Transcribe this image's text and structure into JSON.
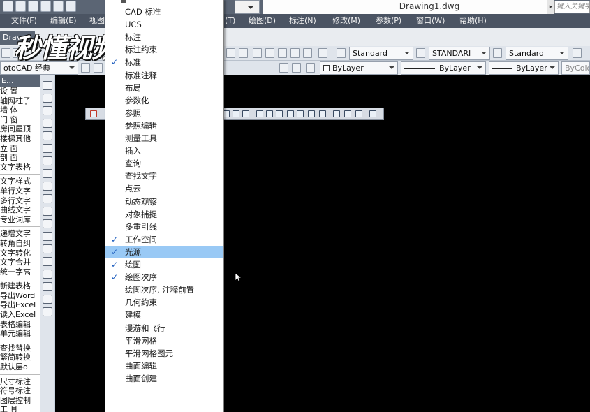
{
  "titlebar": {
    "document_title": "Drawing1.dwg",
    "search_placeholder": "键入关键字"
  },
  "menubar": {
    "items": [
      {
        "label": "文件(F)"
      },
      {
        "label": "编辑(E)"
      },
      {
        "label": "视图"
      },
      {
        "label": "(T)"
      },
      {
        "label": "绘图(D)"
      },
      {
        "label": "标注(N)"
      },
      {
        "label": "修改(M)"
      },
      {
        "label": "参数(P)"
      },
      {
        "label": "窗口(W)"
      },
      {
        "label": "帮助(H)"
      }
    ]
  },
  "tabs": {
    "drawing_tab": "Drav"
  },
  "toolbar": {
    "text_style": "Standard",
    "dim_style": "STANDARI",
    "table_style": "Standard",
    "workspace": "otoCAD 经典",
    "layer_color": "ByLayer",
    "linetype": "ByLayer",
    "lineweight": "ByLayer",
    "plot_style": "ByColo"
  },
  "left_panel": {
    "header": "E...",
    "groups": [
      [
        "设      置",
        "轴网柱子",
        "墙      体",
        "门      窗",
        "房间屋顶",
        "楼梯其他",
        "立      面",
        "剖      面",
        "文字表格"
      ],
      [
        "文字样式",
        "单行文字",
        "多行文字",
        "曲线文字",
        "专业词库"
      ],
      [
        "递增文字",
        "转角自纠",
        "文字转化",
        "文字合并",
        "统一字高"
      ],
      [
        "新建表格",
        "导出Word",
        "导出Excel",
        "读入Excel",
        "表格编辑",
        "单元编辑"
      ],
      [
        "查找替换",
        "繁简转换",
        "默认层o"
      ],
      [
        "尺寸标注",
        "符号标注",
        "图层控制",
        "工      具"
      ]
    ]
  },
  "watermark": {
    "text": "秒懂视频"
  },
  "context_menu": {
    "items": [
      {
        "label": "CAD 标准",
        "checked": false,
        "hover": false
      },
      {
        "label": "UCS",
        "checked": false,
        "hover": false
      },
      {
        "label": "标注",
        "checked": false,
        "hover": false
      },
      {
        "label": "标注约束",
        "checked": false,
        "hover": false
      },
      {
        "label": "标准",
        "checked": true,
        "hover": false
      },
      {
        "label": "标准注释",
        "checked": false,
        "hover": false
      },
      {
        "label": "布局",
        "checked": false,
        "hover": false
      },
      {
        "label": "参数化",
        "checked": false,
        "hover": false
      },
      {
        "label": "参照",
        "checked": false,
        "hover": false
      },
      {
        "label": "参照编辑",
        "checked": false,
        "hover": false
      },
      {
        "label": "测量工具",
        "checked": false,
        "hover": false
      },
      {
        "label": "插入",
        "checked": false,
        "hover": false
      },
      {
        "label": "查询",
        "checked": false,
        "hover": false
      },
      {
        "label": "查找文字",
        "checked": false,
        "hover": false
      },
      {
        "label": "点云",
        "checked": false,
        "hover": false
      },
      {
        "label": "动态观察",
        "checked": false,
        "hover": false
      },
      {
        "label": "对象捕捉",
        "checked": false,
        "hover": false
      },
      {
        "label": "多重引线",
        "checked": false,
        "hover": false
      },
      {
        "label": "工作空间",
        "checked": true,
        "hover": false
      },
      {
        "label": "光源",
        "checked": true,
        "hover": true
      },
      {
        "label": "绘图",
        "checked": true,
        "hover": false
      },
      {
        "label": "绘图次序",
        "checked": true,
        "hover": false
      },
      {
        "label": "绘图次序, 注释前置",
        "checked": false,
        "hover": false
      },
      {
        "label": "几何约束",
        "checked": false,
        "hover": false
      },
      {
        "label": "建模",
        "checked": false,
        "hover": false
      },
      {
        "label": "漫游和飞行",
        "checked": false,
        "hover": false
      },
      {
        "label": "平滑网格",
        "checked": false,
        "hover": false
      },
      {
        "label": "平滑网格图元",
        "checked": false,
        "hover": false
      },
      {
        "label": "曲面编辑",
        "checked": false,
        "hover": false
      },
      {
        "label": "曲面创建",
        "checked": false,
        "hover": false
      }
    ]
  },
  "colors": {
    "menubar_bg": "#4b5463",
    "drawing_bg": "#000000",
    "menu_hover": "#99c9f5",
    "check": "#1f5fbf"
  }
}
